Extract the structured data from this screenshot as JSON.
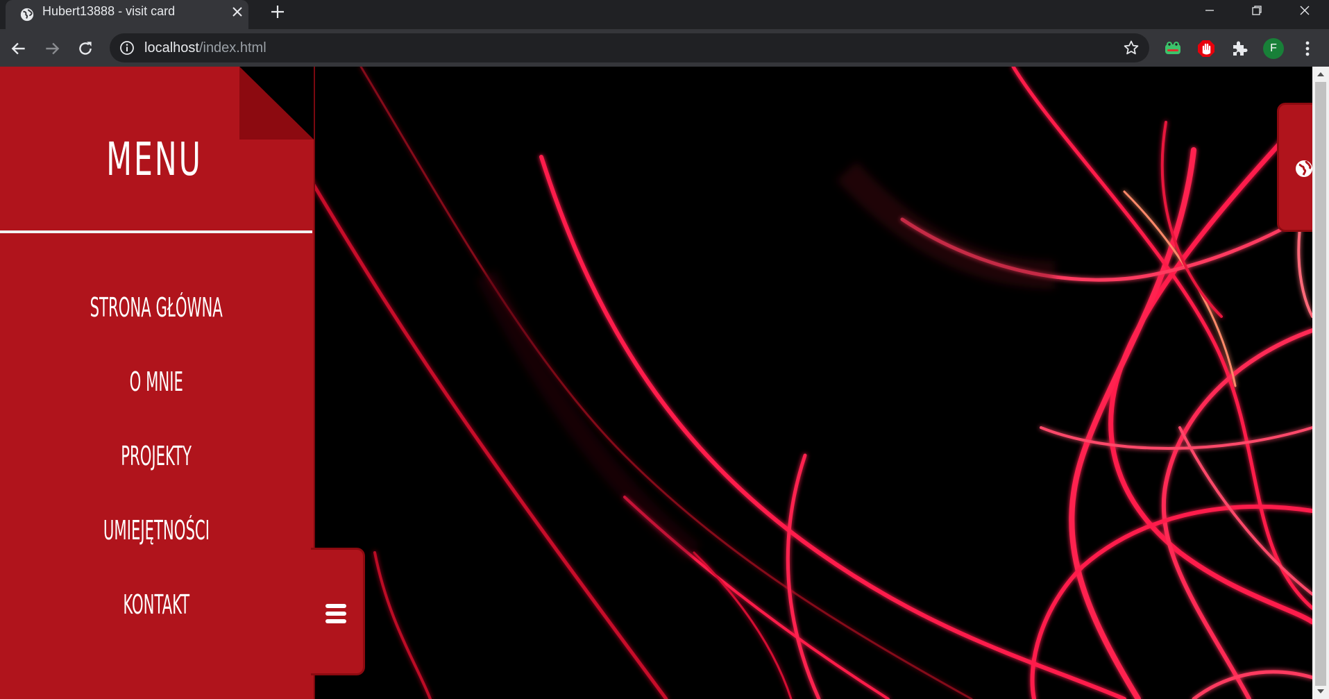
{
  "browser": {
    "tab_title": "Hubert13888 - visit card",
    "url_host": "localhost",
    "url_path": "/index.html",
    "profile_initial": "F"
  },
  "icons": {
    "tab_favicon": "globe-icon",
    "tab_close": "close-icon",
    "new_tab": "plus-icon",
    "back": "back-arrow-icon",
    "forward": "forward-arrow-icon",
    "reload": "reload-icon",
    "site_info": "info-icon",
    "bookmark": "star-icon",
    "extensions": [
      "frog-extension-icon",
      "adblock-hand-icon",
      "puzzle-extensions-icon"
    ],
    "menu": "kebab-menu-icon",
    "hamburger": "hamburger-icon",
    "side_globe": "globe-icon"
  },
  "menu": {
    "title": "MENU",
    "items": [
      {
        "label": "STRONA GŁÓWNA"
      },
      {
        "label": "O MNIE"
      },
      {
        "label": "PROJEKTY"
      },
      {
        "label": "UMIEJĘTNOŚCI"
      },
      {
        "label": "KONTAKT"
      }
    ]
  },
  "colors": {
    "menu_red": "#b0141c",
    "menu_dark_red": "#8c0a10",
    "background": "#000000",
    "light_streaks": "#ff1a4a"
  }
}
